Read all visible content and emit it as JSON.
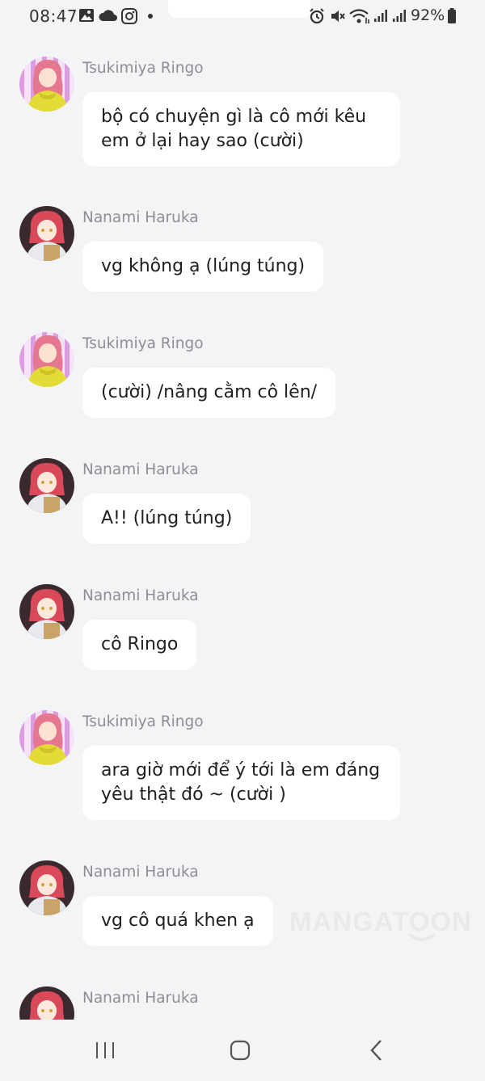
{
  "status_bar": {
    "time": "08:47",
    "battery": "92%",
    "icons": [
      "gallery-icon",
      "cloud-icon",
      "instagram-icon",
      "dot-icon",
      "alarm-icon",
      "mute-icon",
      "wifi-icon",
      "signal-icon",
      "signal-icon",
      "battery-icon"
    ]
  },
  "messages": [
    {
      "sender": "Tsukimiya Ringo",
      "text": "bộ có chuyện gì là cô mới kêu em ở lại hay sao (cười)",
      "avatar": "ringo"
    },
    {
      "sender": "Nanami Haruka",
      "text": "vg không ạ (lúng túng)",
      "avatar": "haruka"
    },
    {
      "sender": "Tsukimiya Ringo",
      "text": "(cười) /nâng cằm cô lên/",
      "avatar": "ringo"
    },
    {
      "sender": "Nanami Haruka",
      "text": "A!! (lúng túng)",
      "avatar": "haruka"
    },
    {
      "sender": "Nanami Haruka",
      "text": "cô Ringo",
      "avatar": "haruka"
    },
    {
      "sender": "Tsukimiya Ringo",
      "text": "ara giờ mới để ý tới là em đáng yêu thật đó ~ (cười )",
      "avatar": "ringo"
    },
    {
      "sender": "Nanami Haruka",
      "text": "vg cô quá khen ạ",
      "avatar": "haruka"
    },
    {
      "sender": "Nanami Haruka",
      "text": "",
      "avatar": "haruka"
    }
  ],
  "watermark": "MANGATOON",
  "nav_bar": {
    "buttons": [
      "recent-apps",
      "home",
      "back"
    ]
  }
}
